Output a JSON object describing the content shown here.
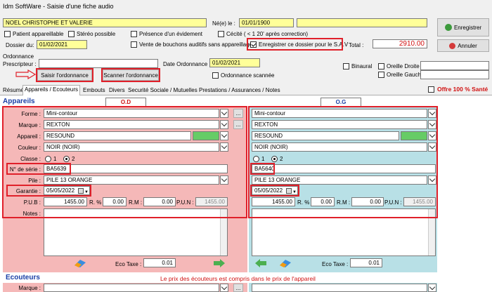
{
  "window": {
    "title": "Idm SoftWare - Saisie d'une fiche audio"
  },
  "patient": {
    "name": "NOEL CHRISTOPHE ET VALERIE",
    "birth_label": "Né(e) le :",
    "birth_date": "01/01/1900"
  },
  "checks": {
    "patient_appareillable": "Patient appareillable",
    "stereo": "Stéréo possible",
    "evidement": "Présence d'un évidement",
    "cecite": "Cécité ( < 1 20' après correction)",
    "bouchons": "Vente de bouchons auditifs sans appareillage",
    "sav": "Enregistrer ce dossier pour le S.A.V",
    "binaural": "Binaural",
    "oreille_droite": "Oreille Droite",
    "oreille_gauche": "Oreille Gauche",
    "ord_scannee": "Ordonnance scannée",
    "offre": "Offre 100 % Santé"
  },
  "dossier": {
    "label": "Dossier du:",
    "date": "01/02/2021"
  },
  "total": {
    "label": "Total :",
    "value": "2910.00"
  },
  "buttons": {
    "enregistrer": "Enregistrer",
    "annuler": "Annuler",
    "saisir": "Saisir l'ordonnance",
    "scanner": "Scanner l'ordonnance",
    "ellipsis": "..."
  },
  "ordonnance": {
    "label": "Ordonnance",
    "prescripteur_label": "Prescripteur :",
    "date_label": "Date Ordonnance :",
    "date": "01/02/2021"
  },
  "tabs": [
    "Résumé",
    "Appareils / Ecouteurs",
    "Embouts",
    "Divers",
    "Securité Sociale / Mutuelles",
    "Prestations / Assurances / Notes"
  ],
  "section": {
    "appareils": "Appareils",
    "od": "O.D",
    "og": "O.G",
    "ecouteurs": "Ecouteurs",
    "ecouteurs_note": "Le prix des écouteurs est compris dans le prix de l'appareil"
  },
  "labels": {
    "forme": "Forme :",
    "marque": "Marque :",
    "appareil": "Appareil :",
    "couleur": "Couleur :",
    "classe": "Classe :",
    "serie": "N° de série :",
    "pile": "Pile :",
    "garantie": "Garantie :",
    "pub": "P.U.B :",
    "r": "R. % :",
    "rm": "R.M :",
    "pun": "P.U.N :",
    "notes": "Notes :",
    "eco": "Eco Taxe :",
    "classe1": "1",
    "classe2": "2"
  },
  "od": {
    "forme": "Mini-contour",
    "marque": "REXTON",
    "appareil": "RESOUND",
    "couleur": "NOIR (NOIR)",
    "serie": "BA5639",
    "pile": "PILE 13 ORANGE",
    "garantie": "05/05/2022",
    "pub": "1455.00",
    "r": "0.00",
    "rm": "0.00",
    "pun": "1455.00",
    "eco": "0.01"
  },
  "og": {
    "forme": "Mini-contour",
    "marque": "REXTON",
    "appareil": "RESOUND",
    "couleur": "NOIR (NOIR)",
    "serie": "BA5640",
    "pile": "PILE 13 ORANGE",
    "garantie": "05/05/2022",
    "pub": "1455.00",
    "r": "0.00",
    "rm": "0.00",
    "pun": "1455.00",
    "eco": "0.01"
  },
  "colors": {
    "od_bg": "#f5b8b8",
    "og_bg": "#b8e0e6",
    "accent_red": "#e0202a",
    "yellow": "#ffff99"
  }
}
